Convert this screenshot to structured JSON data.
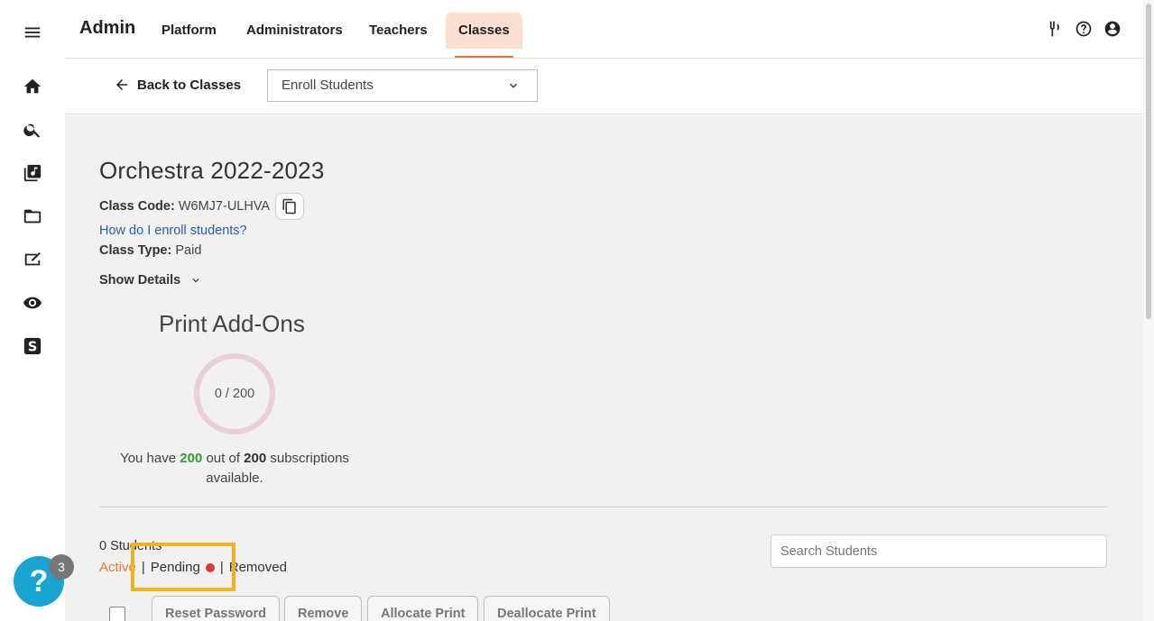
{
  "header": {
    "brand": "Admin",
    "nav": [
      "Platform",
      "Administrators",
      "Teachers",
      "Classes"
    ],
    "active_nav": "Classes"
  },
  "subbar": {
    "back_label": "Back to Classes",
    "select_value": "Enroll Students"
  },
  "class_info": {
    "title": "Orchestra 2022-2023",
    "code_label": "Class Code:",
    "code_value": "W6MJ7-ULHVA",
    "enroll_link": "How do I enroll students?",
    "type_label": "Class Type:",
    "type_value": "Paid",
    "show_details": "Show Details"
  },
  "print_addons": {
    "title": "Print Add-Ons",
    "ring_text": "0 / 200",
    "used": 0,
    "total": 200,
    "text_before": "You have",
    "available": "200",
    "text_middle": "out of",
    "total_label": "200",
    "text_after": "subscriptions available."
  },
  "students": {
    "count_label": "0 Students",
    "tabs": [
      "Active",
      "Pending",
      "Removed"
    ],
    "active_tab": "Active",
    "search_placeholder": "Search Students",
    "actions": [
      "Reset Password",
      "Remove",
      "Allocate Print",
      "Deallocate Print"
    ]
  },
  "help": {
    "symbol": "?",
    "badge": "3"
  },
  "colors": {
    "accent": "#e77a2f",
    "active_nav_bg": "#fbe0d2",
    "link": "#2a5ea8",
    "green": "#3a9a35",
    "pending_dot": "#d93939",
    "highlight": "#f2b21d",
    "help_bg": "#19a3d1"
  },
  "icons": {
    "rail": [
      "menu-icon",
      "home-icon",
      "search-icon",
      "music-library-icon",
      "folder-icon",
      "assignment-icon",
      "eye-icon",
      "s-logo-icon"
    ],
    "header": [
      "tuning-fork-icon",
      "help-circle-icon",
      "account-icon"
    ]
  }
}
